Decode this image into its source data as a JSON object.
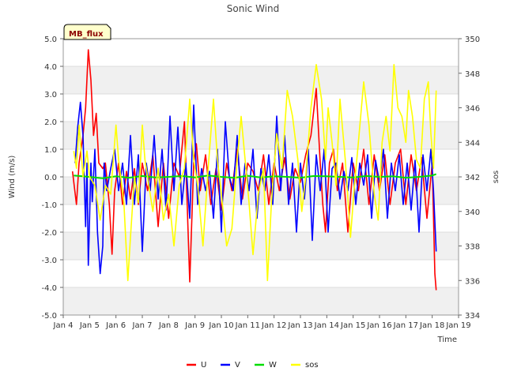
{
  "chart_data": {
    "type": "line",
    "title": "Sonic Wind",
    "badge": "MB_flux",
    "xlabel": "Time",
    "ylabel_left": "Wind (m/s)",
    "ylabel_right": "sos",
    "x_ticks": [
      "Jan 4",
      "Jan 5",
      "Jan 6",
      "Jan 7",
      "Jan 8",
      "Jan 9",
      "Jan 10",
      "Jan 11",
      "Jan 12",
      "Jan 13",
      "Jan 14",
      "Jan 15",
      "Jan 16",
      "Jan 17",
      "Jan 18",
      "Jan 19"
    ],
    "xlim_days": [
      4,
      19
    ],
    "ylim_left": [
      -5.0,
      5.0
    ],
    "yticks_left": [
      "-5.0",
      "-4.0",
      "-3.0",
      "-2.0",
      "-1.0",
      "0.0",
      "1.0",
      "2.0",
      "3.0",
      "4.0",
      "5.0"
    ],
    "ylim_right": [
      334,
      350
    ],
    "yticks_right": [
      "334",
      "336",
      "338",
      "340",
      "342",
      "344",
      "346",
      "348",
      "350"
    ],
    "grid": "horizontal bands",
    "legend_placement": "bottom",
    "series": [
      {
        "name": "U",
        "color": "#ff0000",
        "axis": "left",
        "x": [
          4.35,
          4.5,
          4.6,
          4.75,
          4.85,
          4.95,
          5.05,
          5.15,
          5.25,
          5.35,
          5.5,
          5.6,
          5.75,
          5.85,
          5.95,
          6.1,
          6.25,
          6.4,
          6.55,
          6.7,
          6.85,
          7.0,
          7.2,
          7.4,
          7.6,
          7.8,
          8.0,
          8.2,
          8.4,
          8.6,
          8.8,
          8.95,
          9.05,
          9.2,
          9.4,
          9.6,
          9.8,
          10.0,
          10.2,
          10.4,
          10.6,
          10.8,
          11.0,
          11.2,
          11.4,
          11.6,
          11.8,
          12.0,
          12.2,
          12.4,
          12.6,
          12.8,
          13.0,
          13.2,
          13.4,
          13.6,
          13.75,
          13.85,
          13.95,
          14.1,
          14.25,
          14.4,
          14.6,
          14.8,
          15.0,
          15.2,
          15.4,
          15.6,
          15.8,
          16.0,
          16.2,
          16.4,
          16.6,
          16.8,
          17.0,
          17.2,
          17.4,
          17.6,
          17.8,
          18.0,
          18.1,
          18.15
        ],
        "values": [
          0.2,
          -1.0,
          0.5,
          1.5,
          2.5,
          4.6,
          3.5,
          1.5,
          2.3,
          0.5,
          0.3,
          0.5,
          -1.0,
          -2.8,
          -0.5,
          0.5,
          -1.0,
          0.2,
          -0.8,
          0.3,
          -1.0,
          0.5,
          -0.5,
          0.8,
          -1.8,
          0.5,
          -1.5,
          0.5,
          0.0,
          2.0,
          -3.8,
          0.5,
          1.2,
          -0.5,
          0.8,
          -1.0,
          0.3,
          -1.2,
          0.5,
          -0.5,
          1.0,
          -0.8,
          0.5,
          0.2,
          -0.5,
          0.8,
          -1.0,
          0.5,
          -0.5,
          0.7,
          -0.8,
          0.3,
          -0.2,
          0.8,
          1.5,
          3.2,
          0.5,
          -1.0,
          -2.0,
          0.5,
          1.0,
          -0.5,
          0.5,
          -2.0,
          0.5,
          -0.5,
          1.0,
          -1.0,
          0.8,
          -0.5,
          0.8,
          -1.0,
          0.5,
          1.0,
          -1.0,
          0.8,
          -0.5,
          0.7,
          -1.5,
          0.5,
          -3.5,
          -4.1
        ]
      },
      {
        "name": "V",
        "color": "#0000ff",
        "axis": "left",
        "x": [
          4.45,
          4.55,
          4.65,
          4.75,
          4.85,
          4.9,
          4.95,
          5.0,
          5.05,
          5.1,
          5.2,
          5.3,
          5.4,
          5.5,
          5.55,
          5.65,
          5.8,
          5.95,
          6.1,
          6.25,
          6.4,
          6.55,
          6.7,
          6.85,
          7.0,
          7.15,
          7.3,
          7.45,
          7.6,
          7.75,
          7.9,
          8.05,
          8.2,
          8.35,
          8.5,
          8.65,
          8.8,
          8.95,
          9.1,
          9.25,
          9.4,
          9.55,
          9.7,
          9.85,
          10.0,
          10.15,
          10.3,
          10.45,
          10.6,
          10.75,
          10.9,
          11.05,
          11.2,
          11.35,
          11.5,
          11.65,
          11.8,
          11.95,
          12.1,
          12.25,
          12.4,
          12.55,
          12.7,
          12.85,
          13.0,
          13.15,
          13.3,
          13.45,
          13.6,
          13.75,
          13.9,
          14.05,
          14.2,
          14.35,
          14.5,
          14.65,
          14.8,
          14.95,
          15.1,
          15.25,
          15.4,
          15.55,
          15.7,
          15.85,
          16.0,
          16.15,
          16.3,
          16.45,
          16.6,
          16.75,
          16.9,
          17.05,
          17.2,
          17.35,
          17.5,
          17.65,
          17.8,
          17.95,
          18.05,
          18.15
        ],
        "values": [
          0.5,
          1.8,
          2.7,
          1.5,
          -1.8,
          0.5,
          -3.2,
          -1.5,
          0.5,
          -0.9,
          1.0,
          -2.0,
          -3.5,
          -2.5,
          0.5,
          -0.5,
          0.3,
          1.0,
          -0.5,
          0.5,
          -1.0,
          1.5,
          -1.0,
          0.8,
          -2.7,
          0.5,
          -0.5,
          1.5,
          -0.8,
          1.0,
          -1.2,
          2.2,
          -0.5,
          1.8,
          -1.0,
          0.5,
          -1.5,
          2.6,
          -1.0,
          0.3,
          -0.5,
          0.2,
          -1.5,
          1.0,
          -2.0,
          2.0,
          0.0,
          -0.5,
          1.5,
          -1.0,
          0.5,
          -0.5,
          1.0,
          -1.5,
          0.3,
          -0.5,
          0.8,
          -1.0,
          2.2,
          -0.5,
          1.5,
          -1.0,
          0.5,
          -2.0,
          0.5,
          -0.8,
          1.0,
          -2.3,
          0.8,
          -0.5,
          1.0,
          -2.0,
          0.3,
          0.5,
          -0.8,
          0.2,
          -0.5,
          0.7,
          -1.0,
          0.5,
          -0.3,
          0.8,
          -1.5,
          0.6,
          -0.2,
          1.0,
          -1.5,
          0.5,
          -0.5,
          0.8,
          -1.0,
          0.5,
          -1.2,
          0.6,
          -2.0,
          0.8,
          -0.5,
          1.0,
          -0.5,
          -2.7
        ]
      },
      {
        "name": "W",
        "color": "#00dd00",
        "axis": "left",
        "x": [
          4.4,
          5.0,
          5.5,
          6.0,
          6.5,
          7.0,
          7.5,
          8.0,
          8.5,
          9.0,
          9.5,
          10.0,
          10.5,
          11.0,
          11.5,
          12.0,
          12.5,
          13.0,
          13.5,
          14.0,
          14.5,
          15.0,
          15.5,
          16.0,
          16.5,
          17.0,
          17.5,
          18.0,
          18.15
        ],
        "values": [
          0.05,
          0.0,
          -0.05,
          0.02,
          -0.03,
          0.03,
          -0.02,
          0.0,
          0.03,
          -0.02,
          0.05,
          0.0,
          -0.03,
          0.04,
          -0.02,
          0.02,
          0.0,
          -0.03,
          0.03,
          0.02,
          0.0,
          -0.02,
          0.03,
          0.0,
          0.02,
          -0.03,
          0.0,
          0.05,
          0.1
        ]
      },
      {
        "name": "sos",
        "color": "#ffff00",
        "axis": "right",
        "x": [
          4.4,
          4.5,
          4.6,
          4.75,
          4.9,
          5.0,
          5.2,
          5.4,
          5.6,
          5.8,
          6.0,
          6.1,
          6.3,
          6.45,
          6.55,
          6.7,
          6.85,
          7.0,
          7.1,
          7.25,
          7.4,
          7.6,
          7.8,
          8.0,
          8.2,
          8.4,
          8.6,
          8.8,
          8.95,
          9.1,
          9.3,
          9.5,
          9.7,
          9.85,
          10.0,
          10.2,
          10.4,
          10.6,
          10.75,
          10.9,
          11.05,
          11.2,
          11.4,
          11.6,
          11.75,
          11.9,
          12.1,
          12.3,
          12.5,
          12.7,
          12.9,
          13.05,
          13.2,
          13.4,
          13.6,
          13.8,
          13.95,
          14.05,
          14.2,
          14.35,
          14.5,
          14.7,
          14.9,
          15.05,
          15.2,
          15.4,
          15.6,
          15.8,
          15.95,
          16.1,
          16.25,
          16.4,
          16.55,
          16.7,
          16.85,
          17.0,
          17.1,
          17.25,
          17.4,
          17.55,
          17.7,
          17.85,
          17.95,
          18.05,
          18.15
        ],
        "values": [
          343.5,
          342.5,
          345.0,
          342.0,
          343.5,
          342.0,
          341.5,
          339.5,
          341.5,
          341.0,
          345.0,
          343.0,
          340.5,
          336.0,
          338.5,
          342.0,
          340.5,
          345.0,
          343.0,
          341.5,
          340.0,
          342.5,
          339.5,
          341.0,
          338.0,
          341.5,
          342.5,
          346.5,
          343.0,
          341.5,
          338.0,
          342.5,
          346.5,
          343.0,
          341.0,
          338.0,
          339.0,
          343.0,
          345.5,
          343.0,
          340.5,
          337.5,
          341.0,
          342.5,
          336.0,
          340.5,
          344.5,
          342.5,
          347.0,
          345.5,
          343.0,
          340.0,
          342.0,
          346.0,
          348.5,
          346.5,
          343.0,
          346.0,
          344.0,
          341.5,
          346.5,
          343.0,
          338.5,
          341.5,
          344.0,
          347.5,
          345.0,
          341.0,
          339.5,
          344.0,
          345.5,
          343.5,
          348.5,
          346.0,
          345.5,
          344.0,
          347.0,
          345.5,
          343.0,
          342.5,
          346.5,
          347.5,
          344.5,
          342.5,
          347.0
        ]
      }
    ]
  }
}
